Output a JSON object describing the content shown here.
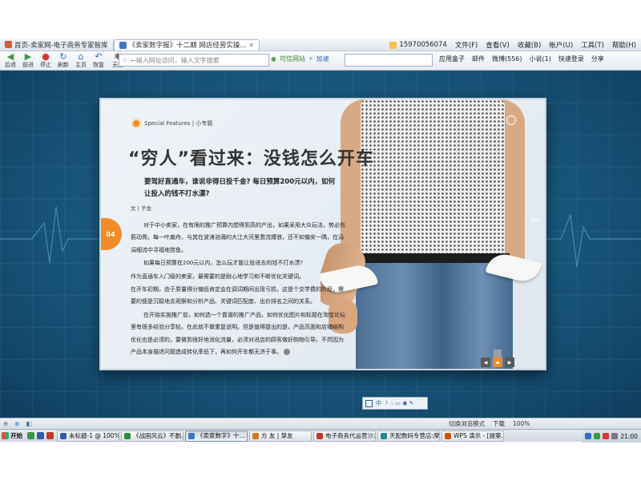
{
  "browser": {
    "tabs": [
      {
        "label": "首页-卖家网-电子商务专家智库",
        "active": false,
        "color": "#e0573b"
      },
      {
        "label": "《卖家数字报》十二期 网店经营实操...",
        "active": true,
        "color": "#3a78c2"
      }
    ],
    "account": "15970056074",
    "menu": [
      "文件(F)",
      "查看(V)",
      "收藏(B)",
      "帐户(U)",
      "工具(T)",
      "帮助(H)"
    ],
    "nav_buttons": [
      {
        "icon": "◀",
        "label": "后退"
      },
      {
        "icon": "▶",
        "label": "前进"
      },
      {
        "icon": "●",
        "label": "停止"
      },
      {
        "icon": "↻",
        "label": "刷新"
      },
      {
        "icon": "⌂",
        "label": "主页"
      },
      {
        "icon": "↶",
        "label": "恢复"
      },
      {
        "icon": "✱",
        "label": "无痕"
      }
    ],
    "address_placeholder": "←输入网址访问，输入文字搜索",
    "trust_label": "可信网站",
    "speed_label": "加速",
    "tools": [
      "应用盒子",
      "邮件",
      "微博(556)",
      "小说(1)",
      "快速登录",
      "分享"
    ]
  },
  "magazine": {
    "section": "Special Features | 小专题",
    "headline": "“穷人”看过来：没钱怎么开车",
    "lead": "要驾好直通车，谁说非得日投千金? 每日预算200元以内，如何让投入的钱不打水漂?",
    "byline": "文 | 子龙",
    "page_number": "04",
    "side_number": "1/4",
    "paragraphs": [
      "对于中小卖家，在有限的推广预算内想得到高的产出，如果采用大众玩法，势必伤筋动骨。每一叶扁舟，与其在波涛汹涌的大江大河里激流搏浪，还不如偏安一隅，在涓涓细流中寻福地捞鱼。",
      "如果每日预算在200元以内，怎么玩才能让投进去的钱不打水漂?",
      "作为直通车入门级的卖家，最需要的是耐心地学习和不断优化关键词。",
      "在开车初期，由于质量得分偏低肯定会在调词期间出现亏损，这是个交学费的阶段，需要的便是沉稳地去观察和分析产品、关键词匹配度、出价排名之间的关系。",
      "在开始实施推广前，如何选一个靠谱的推广产品，如何优化图片和标题在淘宝论坛里有很多经验分享帖，在此就不做重复说明。但是值得提出的是，产品页面和店铺结构优化也是必须的，要做到很好地消化流量，必须对进店的顾客做好购物引导。不然因为产品本身描述问题造成转化率低下，再如何开车都无济于事。"
    ],
    "page_nav": [
      "◀",
      "▪",
      "▶"
    ],
    "reader_bar": "中 ☽ ∴ ▭ ◉ ✎"
  },
  "statusbar": {
    "left": [
      "切换浏览模式"
    ],
    "right": [
      "切换浏览模式",
      "下载",
      "100%"
    ]
  },
  "taskbar": {
    "start_label": "开始",
    "tasks": [
      {
        "label": "未标题-1 @ 100% (...",
        "active": false,
        "color": "#2b5fae"
      },
      {
        "label": "《战国风云》不删...",
        "active": false,
        "color": "#2a8f3a"
      },
      {
        "label": "《卖家数字》十...",
        "active": true,
        "color": "#3a78c2"
      },
      {
        "label": "方 友 | 挚友",
        "active": false,
        "color": "#d07a24"
      },
      {
        "label": "电子商务代运营沙龙",
        "active": false,
        "color": "#c0392b"
      },
      {
        "label": "天配数码专营店:摩...",
        "active": false,
        "color": "#1e8a8a"
      },
      {
        "label": "WPS 演示 - [提案...",
        "active": false,
        "color": "#d35400"
      }
    ],
    "clock": "21:00"
  }
}
